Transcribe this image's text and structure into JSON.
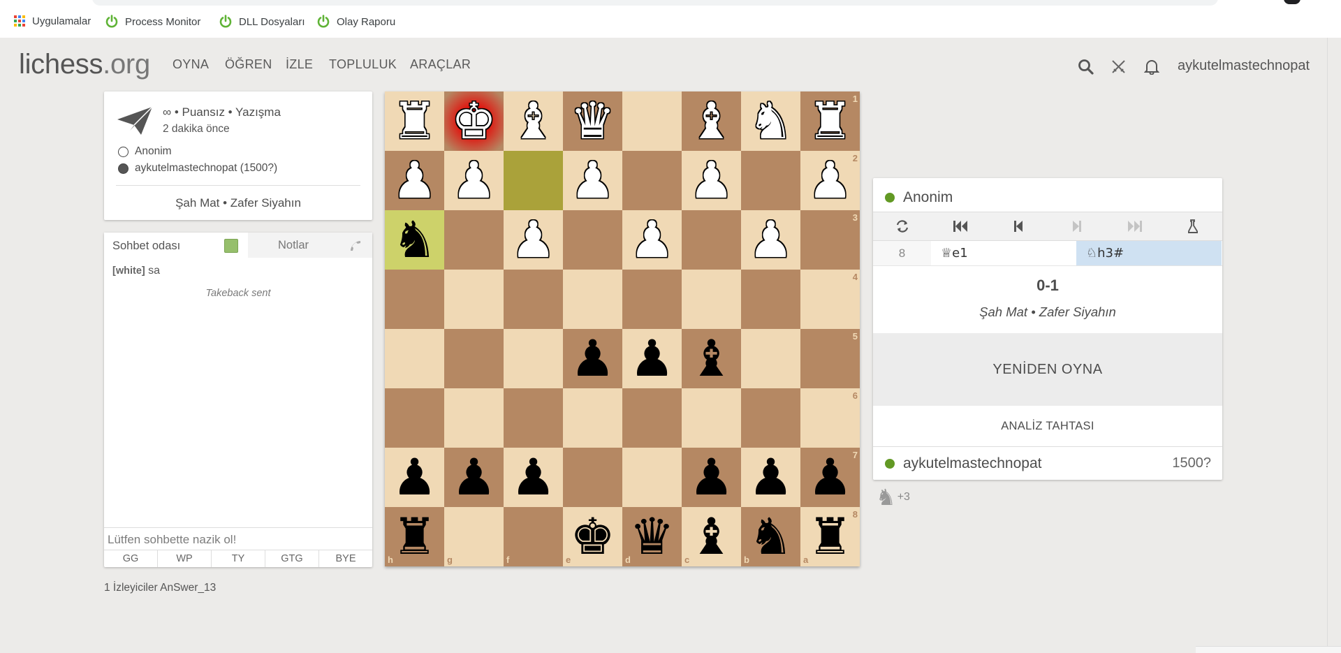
{
  "browser": {
    "bookmarks": [
      {
        "label": "Uygulamalar",
        "icon": "apps-grid-icon"
      },
      {
        "label": "Process Monitor",
        "icon": "power-icon"
      },
      {
        "label": "DLL Dosyaları",
        "icon": "power-icon"
      },
      {
        "label": "Olay Raporu",
        "icon": "power-icon"
      }
    ]
  },
  "header": {
    "logo_main": "lichess",
    "logo_tld": ".org",
    "nav": [
      "OYNA",
      "ÖĞREN",
      "İZLE",
      "TOPLULUK",
      "ARAÇLAR"
    ],
    "icons": [
      "search-icon",
      "swords-icon",
      "bell-icon"
    ],
    "username": "aykutelmastechnopat"
  },
  "game_meta": {
    "title": "∞ • Puansız • Yazışma",
    "time_ago": "2 dakika önce",
    "players": [
      {
        "name": "Anonim",
        "color": "white"
      },
      {
        "name": "aykutelmastechnopat (1500?)",
        "color": "black"
      }
    ],
    "result": "Şah Mat • Zafer Siyahın"
  },
  "chat": {
    "tab_chat": "Sohbet odası",
    "tab_notes": "Notlar",
    "messages": [
      {
        "user": "[white]",
        "text": "sa"
      }
    ],
    "system_message": "Takeback sent",
    "input_placeholder": "Lütfen sohbette nazik ol!",
    "presets": [
      "GG",
      "WP",
      "TY",
      "GTG",
      "BYE"
    ]
  },
  "watchers": "1 İzleyiciler AnSwer_13",
  "board": {
    "orientation": "black",
    "rows": [
      [
        "wR",
        "wK",
        "wB",
        "wQ",
        "",
        "wB",
        "wN",
        "wR"
      ],
      [
        "wP",
        "wP",
        "",
        "wP",
        "",
        "wP",
        "",
        "wP"
      ],
      [
        "bN",
        "",
        "wP",
        "",
        "wP",
        "",
        "wP",
        ""
      ],
      [
        "",
        "",
        "",
        "",
        "",
        "",
        "",
        ""
      ],
      [
        "",
        "",
        "",
        "bP",
        "bP",
        "bB",
        "",
        ""
      ],
      [
        "",
        "",
        "",
        "",
        "",
        "",
        "",
        ""
      ],
      [
        "bP",
        "bP",
        "bP",
        "",
        "",
        "bP",
        "bP",
        "bP"
      ],
      [
        "bR",
        "",
        "",
        "bK",
        "bQ",
        "bB",
        "bN",
        "bR"
      ]
    ],
    "rank_labels": [
      "1",
      "2",
      "3",
      "4",
      "5",
      "6",
      "7",
      "8"
    ],
    "file_labels": [
      "h",
      "g",
      "f",
      "e",
      "d",
      "c",
      "b",
      "a"
    ],
    "last_move": {
      "from": "f2",
      "to": "h3"
    },
    "check_square": "g1",
    "colors": {
      "light": "#f0d9b5",
      "dark": "#b58863",
      "last_from": "#aaa23a",
      "last_to": "#cdd26a"
    }
  },
  "table": {
    "top_player": "Anonim",
    "bottom_player": "aykutelmastechnopat",
    "bottom_rating": "1500?",
    "controls": [
      "flip-board-icon",
      "first-move-icon",
      "prev-move-icon",
      "next-move-icon",
      "last-move-icon",
      "analysis-icon"
    ],
    "move_number": "8",
    "white_move": "♕e1",
    "black_move": "♘h3#",
    "score": "0-1",
    "status": "Şah Mat • Zafer Siyahın",
    "rematch_label": "YENİDEN OYNA",
    "analysis_label": "ANALİZ TAHTASI",
    "online_color": "#629924"
  },
  "material": {
    "piece": "♞",
    "diff": "+3"
  }
}
